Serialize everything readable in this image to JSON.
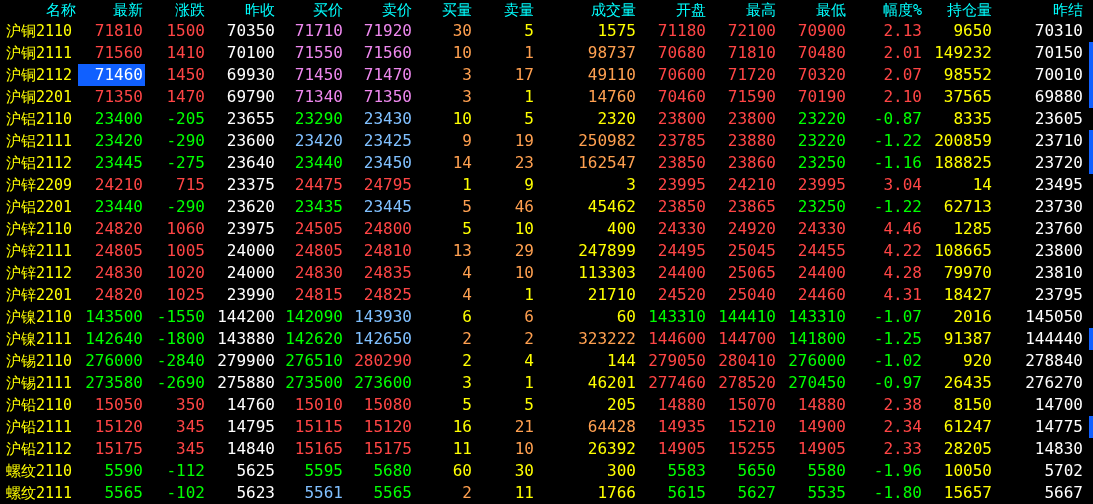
{
  "columns": [
    "名称",
    "最新",
    "涨跌",
    "昨收",
    "买价",
    "卖价",
    "买量",
    "卖量",
    "成交量",
    "开盘",
    "最高",
    "最低",
    "幅度%",
    "持仓量",
    "昨结"
  ],
  "rows": [
    {
      "name": "沪铜2110",
      "selected": false,
      "flagged": false,
      "cells": [
        {
          "text": "71810",
          "color": "#ff4545"
        },
        {
          "text": "1500",
          "color": "#ff4545"
        },
        {
          "text": "70350",
          "color": "#ffffff"
        },
        {
          "text": "71710",
          "color": "#ee88ee"
        },
        {
          "text": "71920",
          "color": "#ee88ee"
        },
        {
          "text": "30",
          "color": "#ffa050"
        },
        {
          "text": "5",
          "color": "#ffff00"
        },
        {
          "text": "1575",
          "color": "#ffff00"
        },
        {
          "text": "71180",
          "color": "#ff4545"
        },
        {
          "text": "72100",
          "color": "#ff4545"
        },
        {
          "text": "70900",
          "color": "#ff4545"
        },
        {
          "text": "2.13",
          "color": "#ff4545"
        },
        {
          "text": "9650",
          "color": "#ffff00"
        },
        {
          "text": "70310",
          "color": "#ffffff"
        }
      ]
    },
    {
      "name": "沪铜2111",
      "selected": false,
      "flagged": true,
      "cells": [
        {
          "text": "71560",
          "color": "#ff4545"
        },
        {
          "text": "1410",
          "color": "#ff4545"
        },
        {
          "text": "70100",
          "color": "#ffffff"
        },
        {
          "text": "71550",
          "color": "#ee88ee"
        },
        {
          "text": "71560",
          "color": "#ee88ee"
        },
        {
          "text": "10",
          "color": "#ffa050"
        },
        {
          "text": "1",
          "color": "#ffa050"
        },
        {
          "text": "98737",
          "color": "#ffa050"
        },
        {
          "text": "70680",
          "color": "#ff4545"
        },
        {
          "text": "71810",
          "color": "#ff4545"
        },
        {
          "text": "70480",
          "color": "#ff4545"
        },
        {
          "text": "2.01",
          "color": "#ff4545"
        },
        {
          "text": "149232",
          "color": "#ffff00"
        },
        {
          "text": "70150",
          "color": "#ffffff"
        }
      ]
    },
    {
      "name": "沪铜2112",
      "selected": true,
      "flagged": true,
      "cells": [
        {
          "text": "71460"
        },
        {
          "text": "1450",
          "color": "#ff4545"
        },
        {
          "text": "69930",
          "color": "#ffffff"
        },
        {
          "text": "71450",
          "color": "#ee88ee"
        },
        {
          "text": "71470",
          "color": "#ee88ee"
        },
        {
          "text": "3",
          "color": "#ffa050"
        },
        {
          "text": "17",
          "color": "#ffa050"
        },
        {
          "text": "49110",
          "color": "#ffa050"
        },
        {
          "text": "70600",
          "color": "#ff4545"
        },
        {
          "text": "71720",
          "color": "#ff4545"
        },
        {
          "text": "70320",
          "color": "#ff4545"
        },
        {
          "text": "2.07",
          "color": "#ff4545"
        },
        {
          "text": "98552",
          "color": "#ffff00"
        },
        {
          "text": "70010",
          "color": "#ffffff"
        }
      ]
    },
    {
      "name": "沪铜2201",
      "selected": false,
      "flagged": true,
      "cells": [
        {
          "text": "71350",
          "color": "#ff4545"
        },
        {
          "text": "1470",
          "color": "#ff4545"
        },
        {
          "text": "69790",
          "color": "#ffffff"
        },
        {
          "text": "71340",
          "color": "#ee88ee"
        },
        {
          "text": "71350",
          "color": "#ee88ee"
        },
        {
          "text": "3",
          "color": "#ffa050"
        },
        {
          "text": "1",
          "color": "#ffff00"
        },
        {
          "text": "14760",
          "color": "#ffa050"
        },
        {
          "text": "70460",
          "color": "#ff4545"
        },
        {
          "text": "71590",
          "color": "#ff4545"
        },
        {
          "text": "70190",
          "color": "#ff4545"
        },
        {
          "text": "2.10",
          "color": "#ff4545"
        },
        {
          "text": "37565",
          "color": "#ffff00"
        },
        {
          "text": "69880",
          "color": "#ffffff"
        }
      ]
    },
    {
      "name": "沪铝2110",
      "selected": false,
      "flagged": false,
      "cells": [
        {
          "text": "23400",
          "color": "#00ff00"
        },
        {
          "text": "-205",
          "color": "#00ff00"
        },
        {
          "text": "23655",
          "color": "#ffffff"
        },
        {
          "text": "23290",
          "color": "#00ff00"
        },
        {
          "text": "23430",
          "color": "#80c0ff"
        },
        {
          "text": "10",
          "color": "#ffff00"
        },
        {
          "text": "5",
          "color": "#ffff00"
        },
        {
          "text": "2320",
          "color": "#ffff00"
        },
        {
          "text": "23800",
          "color": "#ff4545"
        },
        {
          "text": "23800",
          "color": "#ff4545"
        },
        {
          "text": "23220",
          "color": "#00ff00"
        },
        {
          "text": "-0.87",
          "color": "#00ff00"
        },
        {
          "text": "8335",
          "color": "#ffff00"
        },
        {
          "text": "23605",
          "color": "#ffffff"
        }
      ]
    },
    {
      "name": "沪铝2111",
      "selected": false,
      "flagged": true,
      "cells": [
        {
          "text": "23420",
          "color": "#00ff00"
        },
        {
          "text": "-290",
          "color": "#00ff00"
        },
        {
          "text": "23600",
          "color": "#ffffff"
        },
        {
          "text": "23420",
          "color": "#80c0ff"
        },
        {
          "text": "23425",
          "color": "#80c0ff"
        },
        {
          "text": "9",
          "color": "#ffa050"
        },
        {
          "text": "19",
          "color": "#ffa050"
        },
        {
          "text": "250982",
          "color": "#ffa050"
        },
        {
          "text": "23785",
          "color": "#ff4545"
        },
        {
          "text": "23880",
          "color": "#ff4545"
        },
        {
          "text": "23220",
          "color": "#00ff00"
        },
        {
          "text": "-1.22",
          "color": "#00ff00"
        },
        {
          "text": "200859",
          "color": "#ffff00"
        },
        {
          "text": "23710",
          "color": "#ffffff"
        }
      ]
    },
    {
      "name": "沪铝2112",
      "selected": false,
      "flagged": true,
      "cells": [
        {
          "text": "23445",
          "color": "#00ff00"
        },
        {
          "text": "-275",
          "color": "#00ff00"
        },
        {
          "text": "23640",
          "color": "#ffffff"
        },
        {
          "text": "23440",
          "color": "#00ff00"
        },
        {
          "text": "23450",
          "color": "#80c0ff"
        },
        {
          "text": "14",
          "color": "#ffa050"
        },
        {
          "text": "23",
          "color": "#ffa050"
        },
        {
          "text": "162547",
          "color": "#ffa050"
        },
        {
          "text": "23850",
          "color": "#ff4545"
        },
        {
          "text": "23860",
          "color": "#ff4545"
        },
        {
          "text": "23250",
          "color": "#00ff00"
        },
        {
          "text": "-1.16",
          "color": "#00ff00"
        },
        {
          "text": "188825",
          "color": "#ffff00"
        },
        {
          "text": "23720",
          "color": "#ffffff"
        }
      ]
    },
    {
      "name": "沪锌2209",
      "selected": false,
      "flagged": false,
      "cells": [
        {
          "text": "24210",
          "color": "#ff4545"
        },
        {
          "text": "715",
          "color": "#ff4545"
        },
        {
          "text": "23375",
          "color": "#ffffff"
        },
        {
          "text": "24475",
          "color": "#ff4545"
        },
        {
          "text": "24795",
          "color": "#ff4545"
        },
        {
          "text": "1",
          "color": "#ffff00"
        },
        {
          "text": "9",
          "color": "#ffff00"
        },
        {
          "text": "3",
          "color": "#ffff00"
        },
        {
          "text": "23995",
          "color": "#ff4545"
        },
        {
          "text": "24210",
          "color": "#ff4545"
        },
        {
          "text": "23995",
          "color": "#ff4545"
        },
        {
          "text": "3.04",
          "color": "#ff4545"
        },
        {
          "text": "14",
          "color": "#ffff00"
        },
        {
          "text": "23495",
          "color": "#ffffff"
        }
      ]
    },
    {
      "name": "沪铝2201",
      "selected": false,
      "flagged": false,
      "cells": [
        {
          "text": "23440",
          "color": "#00ff00"
        },
        {
          "text": "-290",
          "color": "#00ff00"
        },
        {
          "text": "23620",
          "color": "#ffffff"
        },
        {
          "text": "23435",
          "color": "#00ff00"
        },
        {
          "text": "23445",
          "color": "#80c0ff"
        },
        {
          "text": "5",
          "color": "#ffa050"
        },
        {
          "text": "46",
          "color": "#ffa050"
        },
        {
          "text": "45462",
          "color": "#ffff00"
        },
        {
          "text": "23850",
          "color": "#ff4545"
        },
        {
          "text": "23865",
          "color": "#ff4545"
        },
        {
          "text": "23250",
          "color": "#00ff00"
        },
        {
          "text": "-1.22",
          "color": "#00ff00"
        },
        {
          "text": "62713",
          "color": "#ffff00"
        },
        {
          "text": "23730",
          "color": "#ffffff"
        }
      ]
    },
    {
      "name": "沪锌2110",
      "selected": false,
      "flagged": false,
      "cells": [
        {
          "text": "24820",
          "color": "#ff4545"
        },
        {
          "text": "1060",
          "color": "#ff4545"
        },
        {
          "text": "23975",
          "color": "#ffffff"
        },
        {
          "text": "24505",
          "color": "#ff4545"
        },
        {
          "text": "24800",
          "color": "#ff4545"
        },
        {
          "text": "5",
          "color": "#ffff00"
        },
        {
          "text": "10",
          "color": "#ffff00"
        },
        {
          "text": "400",
          "color": "#ffff00"
        },
        {
          "text": "24330",
          "color": "#ff4545"
        },
        {
          "text": "24920",
          "color": "#ff4545"
        },
        {
          "text": "24330",
          "color": "#ff4545"
        },
        {
          "text": "4.46",
          "color": "#ff4545"
        },
        {
          "text": "1285",
          "color": "#ffff00"
        },
        {
          "text": "23760",
          "color": "#ffffff"
        }
      ]
    },
    {
      "name": "沪锌2111",
      "selected": false,
      "flagged": false,
      "cells": [
        {
          "text": "24805",
          "color": "#ff4545"
        },
        {
          "text": "1005",
          "color": "#ff4545"
        },
        {
          "text": "24000",
          "color": "#ffffff"
        },
        {
          "text": "24805",
          "color": "#ff4545"
        },
        {
          "text": "24810",
          "color": "#ff4545"
        },
        {
          "text": "13",
          "color": "#ffa050"
        },
        {
          "text": "29",
          "color": "#ffa050"
        },
        {
          "text": "247899",
          "color": "#ffff00"
        },
        {
          "text": "24495",
          "color": "#ff4545"
        },
        {
          "text": "25045",
          "color": "#ff4545"
        },
        {
          "text": "24455",
          "color": "#ff4545"
        },
        {
          "text": "4.22",
          "color": "#ff4545"
        },
        {
          "text": "108665",
          "color": "#ffff00"
        },
        {
          "text": "23800",
          "color": "#ffffff"
        }
      ]
    },
    {
      "name": "沪锌2112",
      "selected": false,
      "flagged": false,
      "cells": [
        {
          "text": "24830",
          "color": "#ff4545"
        },
        {
          "text": "1020",
          "color": "#ff4545"
        },
        {
          "text": "24000",
          "color": "#ffffff"
        },
        {
          "text": "24830",
          "color": "#ff4545"
        },
        {
          "text": "24835",
          "color": "#ff4545"
        },
        {
          "text": "4",
          "color": "#ffa050"
        },
        {
          "text": "10",
          "color": "#ffa050"
        },
        {
          "text": "113303",
          "color": "#ffff00"
        },
        {
          "text": "24400",
          "color": "#ff4545"
        },
        {
          "text": "25065",
          "color": "#ff4545"
        },
        {
          "text": "24400",
          "color": "#ff4545"
        },
        {
          "text": "4.28",
          "color": "#ff4545"
        },
        {
          "text": "79970",
          "color": "#ffff00"
        },
        {
          "text": "23810",
          "color": "#ffffff"
        }
      ]
    },
    {
      "name": "沪锌2201",
      "selected": false,
      "flagged": false,
      "cells": [
        {
          "text": "24820",
          "color": "#ff4545"
        },
        {
          "text": "1025",
          "color": "#ff4545"
        },
        {
          "text": "23990",
          "color": "#ffffff"
        },
        {
          "text": "24815",
          "color": "#ff4545"
        },
        {
          "text": "24825",
          "color": "#ff4545"
        },
        {
          "text": "4",
          "color": "#ffa050"
        },
        {
          "text": "1",
          "color": "#ffff00"
        },
        {
          "text": "21710",
          "color": "#ffff00"
        },
        {
          "text": "24520",
          "color": "#ff4545"
        },
        {
          "text": "25040",
          "color": "#ff4545"
        },
        {
          "text": "24460",
          "color": "#ff4545"
        },
        {
          "text": "4.31",
          "color": "#ff4545"
        },
        {
          "text": "18427",
          "color": "#ffff00"
        },
        {
          "text": "23795",
          "color": "#ffffff"
        }
      ]
    },
    {
      "name": "沪镍2110",
      "selected": false,
      "flagged": false,
      "cells": [
        {
          "text": "143500",
          "color": "#00ff00"
        },
        {
          "text": "-1550",
          "color": "#00ff00"
        },
        {
          "text": "144200",
          "color": "#ffffff"
        },
        {
          "text": "142090",
          "color": "#00ff00"
        },
        {
          "text": "143930",
          "color": "#80c0ff"
        },
        {
          "text": "6",
          "color": "#ffff00"
        },
        {
          "text": "6",
          "color": "#ffa050"
        },
        {
          "text": "60",
          "color": "#ffff00"
        },
        {
          "text": "143310",
          "color": "#00ff00"
        },
        {
          "text": "144410",
          "color": "#00ff00"
        },
        {
          "text": "143310",
          "color": "#00ff00"
        },
        {
          "text": "-1.07",
          "color": "#00ff00"
        },
        {
          "text": "2016",
          "color": "#ffff00"
        },
        {
          "text": "145050",
          "color": "#ffffff"
        }
      ]
    },
    {
      "name": "沪镍2111",
      "selected": false,
      "flagged": true,
      "cells": [
        {
          "text": "142640",
          "color": "#00ff00"
        },
        {
          "text": "-1800",
          "color": "#00ff00"
        },
        {
          "text": "143880",
          "color": "#ffffff"
        },
        {
          "text": "142620",
          "color": "#00ff00"
        },
        {
          "text": "142650",
          "color": "#80c0ff"
        },
        {
          "text": "2",
          "color": "#ffa050"
        },
        {
          "text": "2",
          "color": "#ffa050"
        },
        {
          "text": "323222",
          "color": "#ffa050"
        },
        {
          "text": "144600",
          "color": "#ff4545"
        },
        {
          "text": "144700",
          "color": "#ff4545"
        },
        {
          "text": "141800",
          "color": "#00ff00"
        },
        {
          "text": "-1.25",
          "color": "#00ff00"
        },
        {
          "text": "91387",
          "color": "#ffff00"
        },
        {
          "text": "144440",
          "color": "#ffffff"
        }
      ]
    },
    {
      "name": "沪锡2110",
      "selected": false,
      "flagged": false,
      "cells": [
        {
          "text": "276000",
          "color": "#00ff00"
        },
        {
          "text": "-2840",
          "color": "#00ff00"
        },
        {
          "text": "279900",
          "color": "#ffffff"
        },
        {
          "text": "276510",
          "color": "#00ff00"
        },
        {
          "text": "280290",
          "color": "#ff4545"
        },
        {
          "text": "2",
          "color": "#ffff00"
        },
        {
          "text": "4",
          "color": "#ffff00"
        },
        {
          "text": "144",
          "color": "#ffff00"
        },
        {
          "text": "279050",
          "color": "#ff4545"
        },
        {
          "text": "280410",
          "color": "#ff4545"
        },
        {
          "text": "276000",
          "color": "#00ff00"
        },
        {
          "text": "-1.02",
          "color": "#00ff00"
        },
        {
          "text": "920",
          "color": "#ffff00"
        },
        {
          "text": "278840",
          "color": "#ffffff"
        }
      ]
    },
    {
      "name": "沪锡2111",
      "selected": false,
      "flagged": false,
      "cells": [
        {
          "text": "273580",
          "color": "#00ff00"
        },
        {
          "text": "-2690",
          "color": "#00ff00"
        },
        {
          "text": "275880",
          "color": "#ffffff"
        },
        {
          "text": "273500",
          "color": "#00ff00"
        },
        {
          "text": "273600",
          "color": "#00ff00"
        },
        {
          "text": "3",
          "color": "#ffff00"
        },
        {
          "text": "1",
          "color": "#ffff00"
        },
        {
          "text": "46201",
          "color": "#ffff00"
        },
        {
          "text": "277460",
          "color": "#ff4545"
        },
        {
          "text": "278520",
          "color": "#ff4545"
        },
        {
          "text": "270450",
          "color": "#00ff00"
        },
        {
          "text": "-0.97",
          "color": "#00ff00"
        },
        {
          "text": "26435",
          "color": "#ffff00"
        },
        {
          "text": "276270",
          "color": "#ffffff"
        }
      ]
    },
    {
      "name": "沪铅2110",
      "selected": false,
      "flagged": false,
      "cells": [
        {
          "text": "15050",
          "color": "#ff4545"
        },
        {
          "text": "350",
          "color": "#ff4545"
        },
        {
          "text": "14760",
          "color": "#ffffff"
        },
        {
          "text": "15010",
          "color": "#ff4545"
        },
        {
          "text": "15080",
          "color": "#ff4545"
        },
        {
          "text": "5",
          "color": "#ffff00"
        },
        {
          "text": "5",
          "color": "#ffff00"
        },
        {
          "text": "205",
          "color": "#ffff00"
        },
        {
          "text": "14880",
          "color": "#ff4545"
        },
        {
          "text": "15070",
          "color": "#ff4545"
        },
        {
          "text": "14880",
          "color": "#ff4545"
        },
        {
          "text": "2.38",
          "color": "#ff4545"
        },
        {
          "text": "8150",
          "color": "#ffff00"
        },
        {
          "text": "14700",
          "color": "#ffffff"
        }
      ]
    },
    {
      "name": "沪铅2111",
      "selected": false,
      "flagged": true,
      "cells": [
        {
          "text": "15120",
          "color": "#ff4545"
        },
        {
          "text": "345",
          "color": "#ff4545"
        },
        {
          "text": "14795",
          "color": "#ffffff"
        },
        {
          "text": "15115",
          "color": "#ff4545"
        },
        {
          "text": "15120",
          "color": "#ff4545"
        },
        {
          "text": "16",
          "color": "#ffff00"
        },
        {
          "text": "21",
          "color": "#ffa050"
        },
        {
          "text": "64428",
          "color": "#ffa050"
        },
        {
          "text": "14935",
          "color": "#ff4545"
        },
        {
          "text": "15210",
          "color": "#ff4545"
        },
        {
          "text": "14900",
          "color": "#ff4545"
        },
        {
          "text": "2.34",
          "color": "#ff4545"
        },
        {
          "text": "61247",
          "color": "#ffff00"
        },
        {
          "text": "14775",
          "color": "#ffffff"
        }
      ]
    },
    {
      "name": "沪铅2112",
      "selected": false,
      "flagged": false,
      "cells": [
        {
          "text": "15175",
          "color": "#ff4545"
        },
        {
          "text": "345",
          "color": "#ff4545"
        },
        {
          "text": "14840",
          "color": "#ffffff"
        },
        {
          "text": "15165",
          "color": "#ff4545"
        },
        {
          "text": "15175",
          "color": "#ff4545"
        },
        {
          "text": "11",
          "color": "#ffff00"
        },
        {
          "text": "10",
          "color": "#ffa050"
        },
        {
          "text": "26392",
          "color": "#ffff00"
        },
        {
          "text": "14905",
          "color": "#ff4545"
        },
        {
          "text": "15255",
          "color": "#ff4545"
        },
        {
          "text": "14905",
          "color": "#ff4545"
        },
        {
          "text": "2.33",
          "color": "#ff4545"
        },
        {
          "text": "28205",
          "color": "#ffff00"
        },
        {
          "text": "14830",
          "color": "#ffffff"
        }
      ]
    },
    {
      "name": "螺纹2110",
      "selected": false,
      "flagged": false,
      "cells": [
        {
          "text": "5590",
          "color": "#00ff00"
        },
        {
          "text": "-112",
          "color": "#00ff00"
        },
        {
          "text": "5625",
          "color": "#ffffff"
        },
        {
          "text": "5595",
          "color": "#00ff00"
        },
        {
          "text": "5680",
          "color": "#00ff00"
        },
        {
          "text": "60",
          "color": "#ffff00"
        },
        {
          "text": "30",
          "color": "#ffff00"
        },
        {
          "text": "300",
          "color": "#ffff00"
        },
        {
          "text": "5583",
          "color": "#00ff00"
        },
        {
          "text": "5650",
          "color": "#00ff00"
        },
        {
          "text": "5580",
          "color": "#00ff00"
        },
        {
          "text": "-1.96",
          "color": "#00ff00"
        },
        {
          "text": "10050",
          "color": "#ffff00"
        },
        {
          "text": "5702",
          "color": "#ffffff"
        }
      ]
    },
    {
      "name": "螺纹2111",
      "selected": false,
      "flagged": false,
      "cells": [
        {
          "text": "5565",
          "color": "#00ff00"
        },
        {
          "text": "-102",
          "color": "#00ff00"
        },
        {
          "text": "5623",
          "color": "#ffffff"
        },
        {
          "text": "5561",
          "color": "#80c0ff"
        },
        {
          "text": "5565",
          "color": "#00ff00"
        },
        {
          "text": "2",
          "color": "#ffa050"
        },
        {
          "text": "11",
          "color": "#ffff00"
        },
        {
          "text": "1766",
          "color": "#ffff00"
        },
        {
          "text": "5615",
          "color": "#00ff00"
        },
        {
          "text": "5627",
          "color": "#00ff00"
        },
        {
          "text": "5535",
          "color": "#00ff00"
        },
        {
          "text": "-1.80",
          "color": "#00ff00"
        },
        {
          "text": "15657",
          "color": "#ffff00"
        },
        {
          "text": "5667",
          "color": "#ffffff"
        }
      ]
    }
  ]
}
